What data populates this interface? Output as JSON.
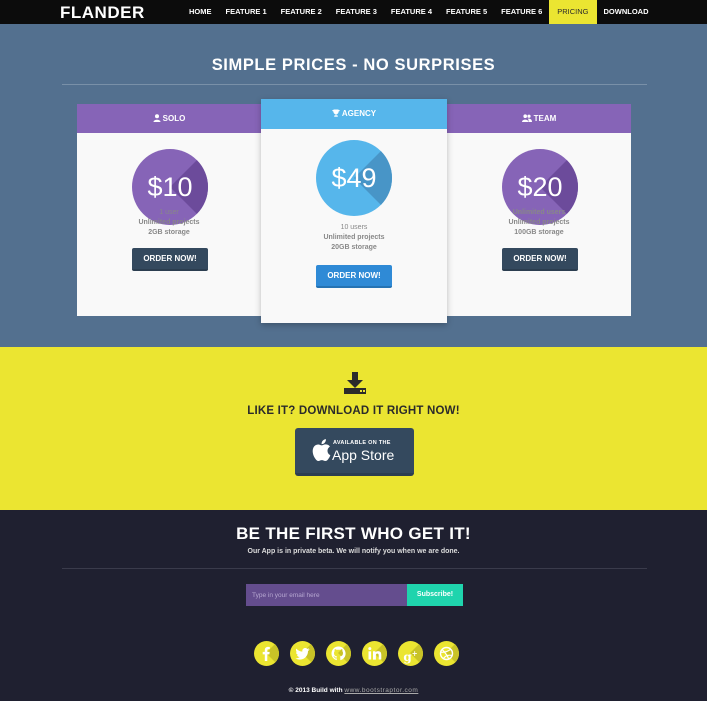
{
  "navbar": {
    "brand": "FLANDER",
    "items": [
      {
        "label": "HOME"
      },
      {
        "label": "FEATURE 1"
      },
      {
        "label": "FEATURE 2"
      },
      {
        "label": "FEATURE 3"
      },
      {
        "label": "FEATURE 4"
      },
      {
        "label": "FEATURE 5"
      },
      {
        "label": "FEATURE 6"
      },
      {
        "label": "PRICING",
        "active": true
      },
      {
        "label": "DOWNLOAD"
      }
    ]
  },
  "pricing": {
    "title": "SIMPLE PRICES - NO SURPRISES",
    "plans": [
      {
        "name": "SOLO",
        "icon": "user-icon",
        "price": "$10",
        "features": [
          "1 user",
          "Unlimited projects",
          "2GB storage"
        ],
        "features_bold": [
          "",
          "Unlimited",
          ""
        ],
        "button": "ORDER NOW!"
      },
      {
        "name": "AGENCY",
        "icon": "trophy-icon",
        "price": "$49",
        "features": [
          "10 users",
          "Unlimited projects",
          "20GB storage"
        ],
        "button": "ORDER NOW!"
      },
      {
        "name": "TEAM",
        "icon": "users-icon",
        "price": "$20",
        "features": [
          "Unlimited users",
          "Unlimited projects",
          "100GB storage"
        ],
        "button": "ORDER NOW!"
      }
    ],
    "colors": {
      "purple": "#8664b7",
      "blue": "#56b6eb",
      "bg": "#53708f"
    }
  },
  "download": {
    "icon": "download-icon",
    "title": "LIKE IT? DOWNLOAD IT RIGHT NOW!",
    "appstore_small": "AVAILABLE ON THE",
    "appstore_big": "App Store"
  },
  "subscribe": {
    "title": "BE THE FIRST WHO GET IT!",
    "subtitle": "Our App is in private beta. We will notify you when we are done.",
    "email_placeholder": "Type in your email here",
    "button": "Subscribe!"
  },
  "socials": [
    "facebook-icon",
    "twitter-icon",
    "github-icon",
    "linkedin-icon",
    "google-plus-icon",
    "dribbble-icon"
  ],
  "footer": {
    "text": "© 2013 Build with",
    "link": "www.bootstraptor.com"
  }
}
